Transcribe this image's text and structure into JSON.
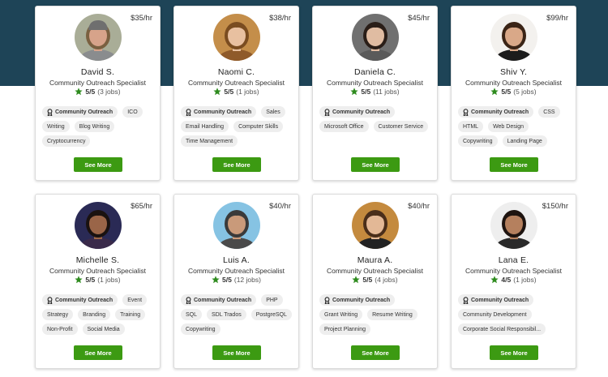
{
  "cards": [
    {
      "name": "David S.",
      "title": "Community Outreach Specialist",
      "rate": "$35/hr",
      "score": "5/5",
      "jobs": "(3 jobs)",
      "skill": "Community Outreach",
      "tags": [
        "ICO",
        "Writing",
        "Blog Writing",
        "Cryptocurrency"
      ],
      "button": "See More",
      "avatar": {
        "bg": "#a9ad97",
        "skin": "#d7a38a",
        "hair": "#7a6040",
        "shirt": "#8a8c8e",
        "cap": "#6f6f6f"
      }
    },
    {
      "name": "Naomi C.",
      "title": "Community Outreach Specialist",
      "rate": "$38/hr",
      "score": "5/5",
      "jobs": "(1 jobs)",
      "skill": "Community Outreach",
      "tags": [
        "Sales",
        "Email Handling",
        "Computer Skills",
        "Time Management"
      ],
      "button": "See More",
      "avatar": {
        "bg": "#c48e4a",
        "skin": "#e8c0a0",
        "hair": "#7a4c20",
        "shirt": "#8f5a2a",
        "cap": ""
      }
    },
    {
      "name": "Daniela C.",
      "title": "Community Outreach Specialist",
      "rate": "$45/hr",
      "score": "5/5",
      "jobs": "(11 jobs)",
      "skill": "Community Outreach",
      "tags": [
        "Microsoft Office",
        "Customer Service"
      ],
      "button": "See More",
      "avatar": {
        "bg": "#707070",
        "skin": "#e0bca2",
        "hair": "#2a1e18",
        "shirt": "#5a5a5a",
        "cap": ""
      }
    },
    {
      "name": "Shiv Y.",
      "title": "Community Outreach Specialist",
      "rate": "$99/hr",
      "score": "5/5",
      "jobs": "(5 jobs)",
      "skill": "Community Outreach",
      "tags": [
        "CSS",
        "HTML",
        "Web Design",
        "Copywriting",
        "Landing Page"
      ],
      "button": "See More",
      "avatar": {
        "bg": "#f3f1ee",
        "skin": "#d9a888",
        "hair": "#3a2416",
        "shirt": "#1c1c1c",
        "cap": ""
      }
    },
    {
      "name": "Michelle S.",
      "title": "Community Outreach Specialist",
      "rate": "$65/hr",
      "score": "5/5",
      "jobs": "(1 jobs)",
      "skill": "Community Outreach",
      "tags": [
        "Event",
        "Strategy",
        "Branding",
        "Training",
        "Non-Profit",
        "Social Media"
      ],
      "button": "See More",
      "avatar": {
        "bg": "#2a2a55",
        "skin": "#9a6548",
        "hair": "#1a1210",
        "shirt": "#3a2a4a",
        "cap": ""
      }
    },
    {
      "name": "Luis A.",
      "title": "Community Outreach Specialist",
      "rate": "$40/hr",
      "score": "5/5",
      "jobs": "(12 jobs)",
      "skill": "Community Outreach",
      "tags": [
        "PHP",
        "SQL",
        "SDL Trados",
        "PostgreSQL",
        "Copywriting"
      ],
      "button": "See More",
      "avatar": {
        "bg": "#86c3e3",
        "skin": "#c99a7a",
        "hair": "#3a3a3a",
        "shirt": "#4a4a4a",
        "cap": ""
      }
    },
    {
      "name": "Maura A.",
      "title": "Community Outreach Specialist",
      "rate": "$40/hr",
      "score": "5/5",
      "jobs": "(4 jobs)",
      "skill": "Community Outreach",
      "tags": [
        "Grant Writing",
        "Resume Writing",
        "Project Planning"
      ],
      "button": "See More",
      "avatar": {
        "bg": "#c48a3e",
        "skin": "#e3b896",
        "hair": "#4a2e1a",
        "shirt": "#222222",
        "cap": ""
      }
    },
    {
      "name": "Lana E.",
      "title": "Community Outreach Specialist",
      "rate": "$150/hr",
      "score": "4/5",
      "jobs": "(1 jobs)",
      "skill": "Community Outreach",
      "tags": [
        "Community Development",
        "Corporate Social Responsibil..."
      ],
      "button": "See More",
      "avatar": {
        "bg": "#eeeeee",
        "skin": "#b5805e",
        "hair": "#1e1410",
        "shirt": "#2a2a2a",
        "cap": ""
      }
    }
  ]
}
